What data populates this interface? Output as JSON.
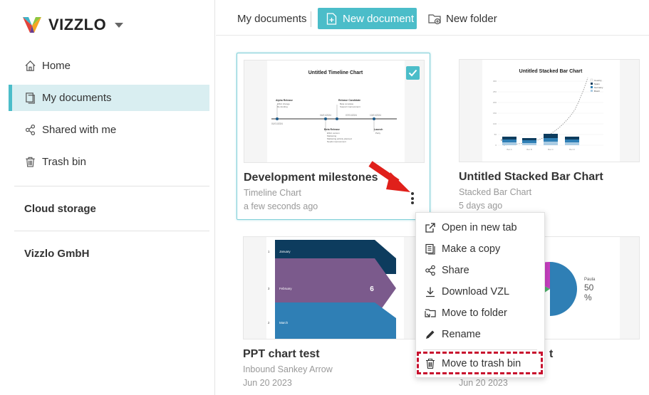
{
  "brand": {
    "name": "VIZZLO"
  },
  "sidebar": {
    "items": [
      {
        "label": "Home",
        "icon": "home-icon"
      },
      {
        "label": "My documents",
        "icon": "documents-icon",
        "active": true
      },
      {
        "label": "Shared with me",
        "icon": "share-icon"
      },
      {
        "label": "Trash bin",
        "icon": "trash-icon"
      }
    ],
    "sections": [
      "Cloud storage",
      "Vizzlo GmbH"
    ]
  },
  "toolbar": {
    "title": "My documents",
    "new_document": "New document",
    "new_folder": "New folder"
  },
  "documents": [
    {
      "title": "Development milestones",
      "type": "Timeline Chart",
      "date": "a few seconds ago",
      "selected": true,
      "thumb": {
        "title": "Untitled Timeline Chart",
        "ticks": [
          "01/01/2024",
          "04/01/2024",
          "07/01/2024",
          "10/01/2024"
        ],
        "milestones": [
          {
            "title": "Alpha Release",
            "lines": [
              "Effort change",
              "Re-funding"
            ]
          },
          {
            "title": "Release Candidate",
            "lines": [
              "Beta complete",
              "Support improvement"
            ]
          },
          {
            "title": "Beta Release",
            "lines": [
              "Effort version",
              "Marketing",
              "Marketing activity planned",
              "Needs improvement"
            ]
          },
          {
            "title": "Launch",
            "lines": [
              "Party"
            ]
          }
        ]
      }
    },
    {
      "title": "Untitled Stacked Bar Chart",
      "type": "Stacked Bar Chart",
      "date": "5 days ago",
      "selected": false,
      "thumb": {
        "title": "Untitled Stacked Bar Chart",
        "legend": [
          "Country",
          "Spain",
          "Germany",
          "Brazil"
        ],
        "annotation": "Example title",
        "categories": [
          "Bar A",
          "Bar B",
          "Bar C",
          "Bar D"
        ]
      }
    },
    {
      "title": "PPT chart test",
      "type": "Inbound Sankey Arrow",
      "date": "Jun 20 2023",
      "selected": false,
      "thumb": {
        "rows": [
          {
            "num": "1",
            "label": "January"
          },
          {
            "num": "3",
            "label": "February"
          },
          {
            "num": "2",
            "label": "March"
          }
        ],
        "value": "6"
      }
    },
    {
      "title": "t",
      "type": "",
      "date": "Jun 20 2023",
      "selected": false,
      "thumb": {
        "label": "Paula",
        "value": "50",
        "unit": "%"
      }
    }
  ],
  "context_menu": {
    "items": [
      {
        "label": "Open in new tab",
        "icon": "external-link-icon"
      },
      {
        "label": "Make a copy",
        "icon": "copy-icon"
      },
      {
        "label": "Share",
        "icon": "share-icon"
      },
      {
        "label": "Download VZL",
        "icon": "download-icon"
      },
      {
        "label": "Move to folder",
        "icon": "move-folder-icon"
      },
      {
        "label": "Rename",
        "icon": "pencil-icon"
      },
      {
        "label": "Move to trash bin",
        "icon": "trash-icon"
      }
    ]
  },
  "colors": {
    "accent": "#4bbdc9",
    "active_bg": "#d9eef1",
    "highlight": "#c8102e",
    "navy": "#0d3c5e",
    "purple": "#7b5a8c",
    "blue": "#2f7fb5"
  }
}
